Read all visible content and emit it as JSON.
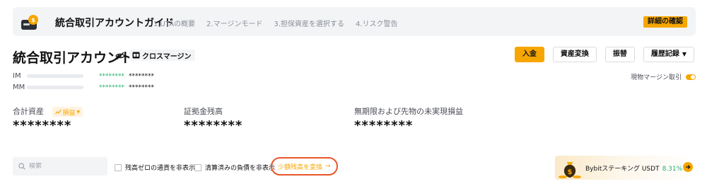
{
  "guide": {
    "title": "統合取引アカウントガイド",
    "steps": [
      "1.UTAの概要",
      "2.マージンモード",
      "3.担保資産を選択する",
      "4.リスク警告"
    ],
    "detail_button": "詳細の確認"
  },
  "account": {
    "title": "統合取引アカウント",
    "mode": "クロスマージン"
  },
  "actions": {
    "deposit": "入金",
    "convert": "資産変換",
    "transfer": "振替",
    "history": "履歴記録"
  },
  "metrics": [
    {
      "label": "IM",
      "value1": "********",
      "value2": "********"
    },
    {
      "label": "MM",
      "value1": "********",
      "value2": "********"
    }
  ],
  "spot_margin": {
    "label": "現物マージン取引",
    "enabled": true
  },
  "balances": {
    "total": {
      "label": "合計資産",
      "tag": "損益",
      "value": "********"
    },
    "margin": {
      "label": "証拠金残高",
      "value": "********"
    },
    "unrealized": {
      "label": "無期限および先物の未実現損益",
      "value": "********"
    }
  },
  "toolbar": {
    "search_placeholder": "検索",
    "hide_zero": "残高ゼロの通貨を非表示",
    "hide_settled": "清算済みの負債を非表示",
    "small_convert": "少額残高を変換"
  },
  "promo": {
    "text": "Bybitステーキング USDT",
    "rate": "8.31%"
  },
  "colors": {
    "accent": "#f7a600",
    "positive": "#20b26c",
    "highlight_ring": "#e8562b"
  }
}
